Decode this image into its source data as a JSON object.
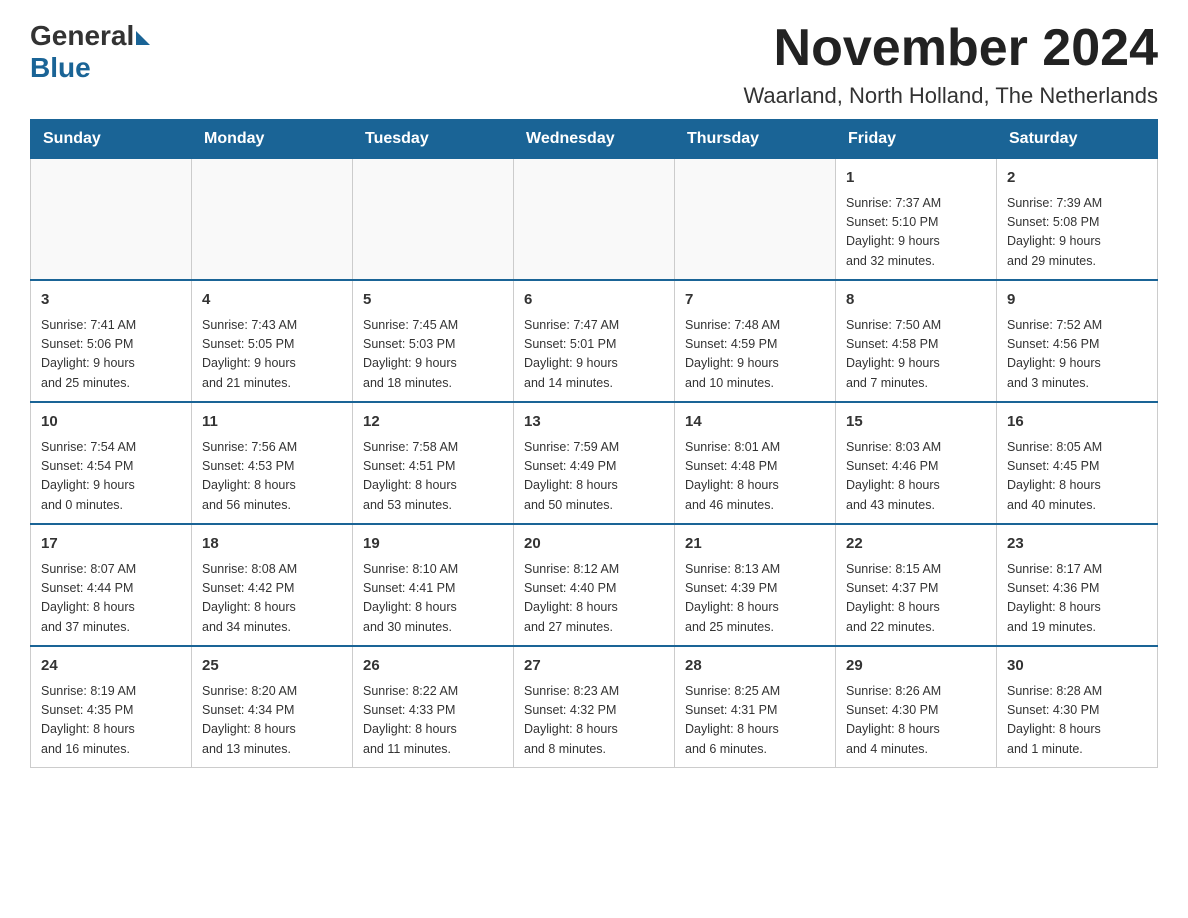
{
  "logo": {
    "general": "General",
    "blue": "Blue"
  },
  "title": "November 2024",
  "location": "Waarland, North Holland, The Netherlands",
  "weekdays": [
    "Sunday",
    "Monday",
    "Tuesday",
    "Wednesday",
    "Thursday",
    "Friday",
    "Saturday"
  ],
  "weeks": [
    [
      {
        "day": "",
        "info": ""
      },
      {
        "day": "",
        "info": ""
      },
      {
        "day": "",
        "info": ""
      },
      {
        "day": "",
        "info": ""
      },
      {
        "day": "",
        "info": ""
      },
      {
        "day": "1",
        "info": "Sunrise: 7:37 AM\nSunset: 5:10 PM\nDaylight: 9 hours\nand 32 minutes."
      },
      {
        "day": "2",
        "info": "Sunrise: 7:39 AM\nSunset: 5:08 PM\nDaylight: 9 hours\nand 29 minutes."
      }
    ],
    [
      {
        "day": "3",
        "info": "Sunrise: 7:41 AM\nSunset: 5:06 PM\nDaylight: 9 hours\nand 25 minutes."
      },
      {
        "day": "4",
        "info": "Sunrise: 7:43 AM\nSunset: 5:05 PM\nDaylight: 9 hours\nand 21 minutes."
      },
      {
        "day": "5",
        "info": "Sunrise: 7:45 AM\nSunset: 5:03 PM\nDaylight: 9 hours\nand 18 minutes."
      },
      {
        "day": "6",
        "info": "Sunrise: 7:47 AM\nSunset: 5:01 PM\nDaylight: 9 hours\nand 14 minutes."
      },
      {
        "day": "7",
        "info": "Sunrise: 7:48 AM\nSunset: 4:59 PM\nDaylight: 9 hours\nand 10 minutes."
      },
      {
        "day": "8",
        "info": "Sunrise: 7:50 AM\nSunset: 4:58 PM\nDaylight: 9 hours\nand 7 minutes."
      },
      {
        "day": "9",
        "info": "Sunrise: 7:52 AM\nSunset: 4:56 PM\nDaylight: 9 hours\nand 3 minutes."
      }
    ],
    [
      {
        "day": "10",
        "info": "Sunrise: 7:54 AM\nSunset: 4:54 PM\nDaylight: 9 hours\nand 0 minutes."
      },
      {
        "day": "11",
        "info": "Sunrise: 7:56 AM\nSunset: 4:53 PM\nDaylight: 8 hours\nand 56 minutes."
      },
      {
        "day": "12",
        "info": "Sunrise: 7:58 AM\nSunset: 4:51 PM\nDaylight: 8 hours\nand 53 minutes."
      },
      {
        "day": "13",
        "info": "Sunrise: 7:59 AM\nSunset: 4:49 PM\nDaylight: 8 hours\nand 50 minutes."
      },
      {
        "day": "14",
        "info": "Sunrise: 8:01 AM\nSunset: 4:48 PM\nDaylight: 8 hours\nand 46 minutes."
      },
      {
        "day": "15",
        "info": "Sunrise: 8:03 AM\nSunset: 4:46 PM\nDaylight: 8 hours\nand 43 minutes."
      },
      {
        "day": "16",
        "info": "Sunrise: 8:05 AM\nSunset: 4:45 PM\nDaylight: 8 hours\nand 40 minutes."
      }
    ],
    [
      {
        "day": "17",
        "info": "Sunrise: 8:07 AM\nSunset: 4:44 PM\nDaylight: 8 hours\nand 37 minutes."
      },
      {
        "day": "18",
        "info": "Sunrise: 8:08 AM\nSunset: 4:42 PM\nDaylight: 8 hours\nand 34 minutes."
      },
      {
        "day": "19",
        "info": "Sunrise: 8:10 AM\nSunset: 4:41 PM\nDaylight: 8 hours\nand 30 minutes."
      },
      {
        "day": "20",
        "info": "Sunrise: 8:12 AM\nSunset: 4:40 PM\nDaylight: 8 hours\nand 27 minutes."
      },
      {
        "day": "21",
        "info": "Sunrise: 8:13 AM\nSunset: 4:39 PM\nDaylight: 8 hours\nand 25 minutes."
      },
      {
        "day": "22",
        "info": "Sunrise: 8:15 AM\nSunset: 4:37 PM\nDaylight: 8 hours\nand 22 minutes."
      },
      {
        "day": "23",
        "info": "Sunrise: 8:17 AM\nSunset: 4:36 PM\nDaylight: 8 hours\nand 19 minutes."
      }
    ],
    [
      {
        "day": "24",
        "info": "Sunrise: 8:19 AM\nSunset: 4:35 PM\nDaylight: 8 hours\nand 16 minutes."
      },
      {
        "day": "25",
        "info": "Sunrise: 8:20 AM\nSunset: 4:34 PM\nDaylight: 8 hours\nand 13 minutes."
      },
      {
        "day": "26",
        "info": "Sunrise: 8:22 AM\nSunset: 4:33 PM\nDaylight: 8 hours\nand 11 minutes."
      },
      {
        "day": "27",
        "info": "Sunrise: 8:23 AM\nSunset: 4:32 PM\nDaylight: 8 hours\nand 8 minutes."
      },
      {
        "day": "28",
        "info": "Sunrise: 8:25 AM\nSunset: 4:31 PM\nDaylight: 8 hours\nand 6 minutes."
      },
      {
        "day": "29",
        "info": "Sunrise: 8:26 AM\nSunset: 4:30 PM\nDaylight: 8 hours\nand 4 minutes."
      },
      {
        "day": "30",
        "info": "Sunrise: 8:28 AM\nSunset: 4:30 PM\nDaylight: 8 hours\nand 1 minute."
      }
    ]
  ]
}
